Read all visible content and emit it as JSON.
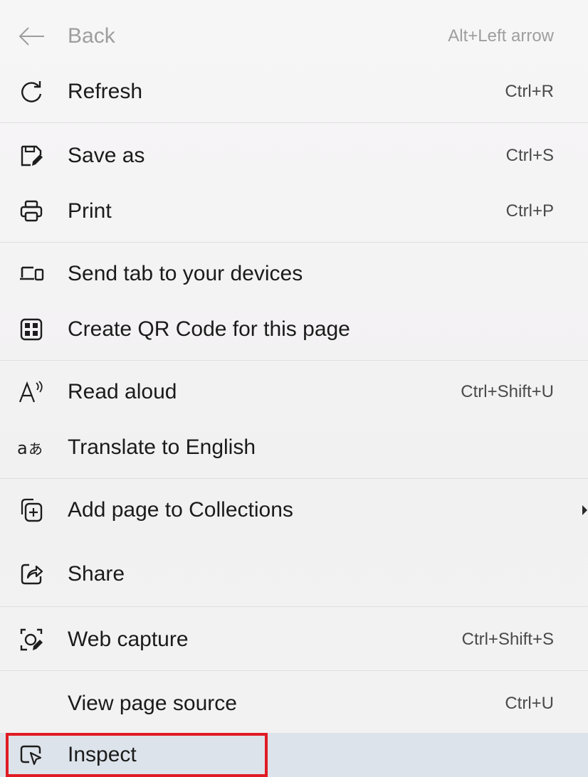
{
  "menu": {
    "items": [
      {
        "key": "back",
        "label": "Back",
        "shortcut": "Alt+Left arrow",
        "icon": "arrow-left-icon",
        "disabled": true
      },
      {
        "key": "refresh",
        "label": "Refresh",
        "shortcut": "Ctrl+R",
        "icon": "refresh-icon"
      },
      {
        "key": "save-as",
        "label": "Save as",
        "shortcut": "Ctrl+S",
        "icon": "save-as-icon"
      },
      {
        "key": "print",
        "label": "Print",
        "shortcut": "Ctrl+P",
        "icon": "printer-icon"
      },
      {
        "key": "send-tab",
        "label": "Send tab to your devices",
        "shortcut": "",
        "icon": "devices-icon"
      },
      {
        "key": "qr-code",
        "label": "Create QR Code for this page",
        "shortcut": "",
        "icon": "qr-code-icon"
      },
      {
        "key": "read-aloud",
        "label": "Read aloud",
        "shortcut": "Ctrl+Shift+U",
        "icon": "read-aloud-icon"
      },
      {
        "key": "translate",
        "label": "Translate to English",
        "shortcut": "",
        "icon": "translate-icon"
      },
      {
        "key": "collections",
        "label": "Add page to Collections",
        "shortcut": "",
        "icon": "collections-icon",
        "submenu": true
      },
      {
        "key": "share",
        "label": "Share",
        "shortcut": "",
        "icon": "share-icon"
      },
      {
        "key": "web-capture",
        "label": "Web capture",
        "shortcut": "Ctrl+Shift+S",
        "icon": "web-capture-icon"
      },
      {
        "key": "view-source",
        "label": "View page source",
        "shortcut": "Ctrl+U",
        "icon": ""
      },
      {
        "key": "inspect",
        "label": "Inspect",
        "shortcut": "",
        "icon": "inspect-icon",
        "selected": true
      }
    ]
  },
  "colors": {
    "highlight_border": "#e01b24",
    "selected_background": "#dde3ea"
  }
}
